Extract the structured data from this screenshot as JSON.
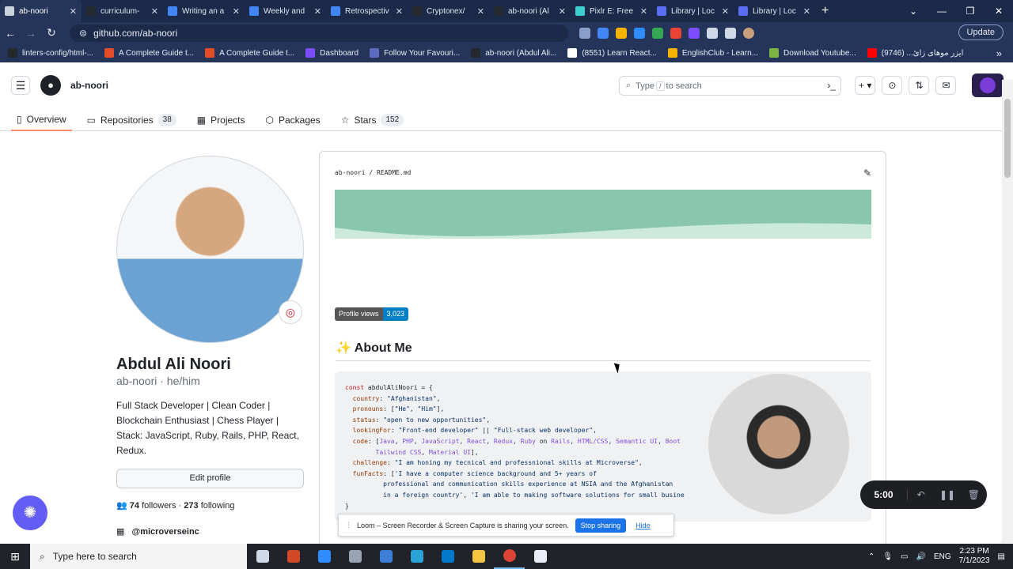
{
  "browser": {
    "tabs": [
      {
        "label": "ab-noori",
        "active": true,
        "color": "#c9d1d9"
      },
      {
        "label": "curriculum-",
        "active": false,
        "color": "#24292f"
      },
      {
        "label": "Writing an a",
        "active": false,
        "color": "#4285f4"
      },
      {
        "label": "Weekly and",
        "active": false,
        "color": "#4285f4"
      },
      {
        "label": "Retrospectiv",
        "active": false,
        "color": "#4285f4"
      },
      {
        "label": "Cryptonex/",
        "active": false,
        "color": "#24292f"
      },
      {
        "label": "ab-noori (Al",
        "active": false,
        "color": "#24292f"
      },
      {
        "label": "Pixlr E: Free",
        "active": false,
        "color": "#3ccfcf"
      },
      {
        "label": "Library | Loc",
        "active": false,
        "color": "#5b6cf5"
      },
      {
        "label": "Library | Loc",
        "active": false,
        "color": "#5b6cf5"
      }
    ],
    "new_tab": "+",
    "url": "github.com/ab-noori",
    "update_label": "Update",
    "bookmarks": [
      {
        "label": "linters-config/html-...",
        "color": "#24292f"
      },
      {
        "label": "A Complete Guide t...",
        "color": "#e34c26"
      },
      {
        "label": "A Complete Guide t...",
        "color": "#e34c26"
      },
      {
        "label": "Dashboard",
        "color": "#7c4dff"
      },
      {
        "label": "Follow Your Favouri...",
        "color": "#5c6bc0"
      },
      {
        "label": "ab-noori (Abdul Ali...",
        "color": "#24292f"
      },
      {
        "label": "(8551) Learn React...",
        "color": "#ffffff"
      },
      {
        "label": "EnglishClub - Learn...",
        "color": "#f4b400"
      },
      {
        "label": "Download Youtube...",
        "color": "#7cb342"
      },
      {
        "label": "ایزر موهای زائ... (9746)",
        "color": "#ff0000"
      }
    ]
  },
  "github": {
    "username": "ab-noori",
    "search_placeholder": "Type / to search",
    "search_prefix": "Type",
    "search_key": "/",
    "search_suffix": "to search",
    "nav": [
      {
        "label": "Overview",
        "icon": "book-icon",
        "glyph": "▯",
        "count": ""
      },
      {
        "label": "Repositories",
        "icon": "repo-icon",
        "glyph": "▭",
        "count": "38"
      },
      {
        "label": "Projects",
        "icon": "table-icon",
        "glyph": "▦",
        "count": ""
      },
      {
        "label": "Packages",
        "icon": "package-icon",
        "glyph": "⬡",
        "count": ""
      },
      {
        "label": "Stars",
        "icon": "star-icon",
        "glyph": "☆",
        "count": "152"
      }
    ]
  },
  "profile": {
    "name": "Abdul Ali Noori",
    "login": "ab-noori · he/him",
    "bio": "Full Stack Developer | Clean Coder | Blockchain Enthusiast | Chess Player | Stack: JavaScript, Ruby, Rails, PHP, React, Redux.",
    "edit_label": "Edit profile",
    "followers": "74",
    "followers_label": "followers ·",
    "following": "273",
    "following_label": "following",
    "org": "@microverseinc"
  },
  "readme": {
    "path": "ab-noori / README.md",
    "badge_label": "Profile views",
    "badge_value": "3,023",
    "about_heading": "About Me"
  },
  "recorder": {
    "time": "5:00",
    "banner_text": "Loom – Screen Recorder & Screen Capture is sharing your screen.",
    "stop_label": "Stop sharing",
    "hide_label": "Hide"
  },
  "taskbar": {
    "search_placeholder": "Type here to search",
    "lang": "ENG",
    "time": "2:23 PM",
    "date": "7/1/2023"
  },
  "colors": {
    "wave_dark": "#88c7ad",
    "wave_light": "#cde9dc",
    "accent_tab": "#fd8c73"
  }
}
